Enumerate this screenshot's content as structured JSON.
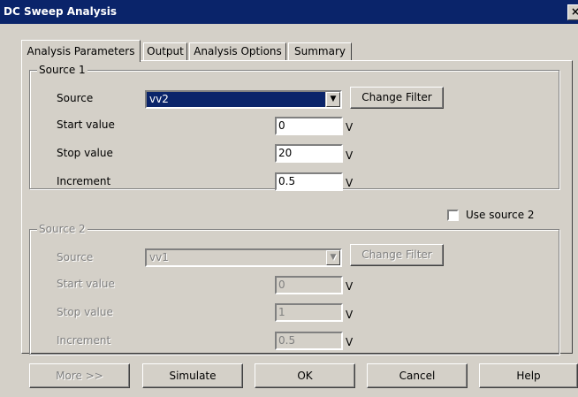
{
  "window": {
    "title": "DC Sweep Analysis",
    "close_label": "×"
  },
  "tabs": [
    "Analysis Parameters",
    "Output",
    "Analysis Options",
    "Summary"
  ],
  "source1": {
    "legend": "Source 1",
    "source_label": "Source",
    "source_value": "vv2",
    "change_filter": "Change Filter",
    "start_label": "Start value",
    "start_value": "0",
    "stop_label": "Stop value",
    "stop_value": "20",
    "increment_label": "Increment",
    "increment_value": "0.5",
    "unit": "V"
  },
  "use_source2": {
    "label": "Use source 2",
    "checked": false
  },
  "source2": {
    "legend": "Source 2",
    "source_label": "Source",
    "source_value": "vv1",
    "change_filter": "Change Filter",
    "start_label": "Start value",
    "start_value": "0",
    "stop_label": "Stop value",
    "stop_value": "1",
    "increment_label": "Increment",
    "increment_value": "0.5",
    "unit": "V"
  },
  "buttons": {
    "more": "More >>",
    "simulate": "Simulate",
    "ok": "OK",
    "cancel": "Cancel",
    "help": "Help"
  }
}
